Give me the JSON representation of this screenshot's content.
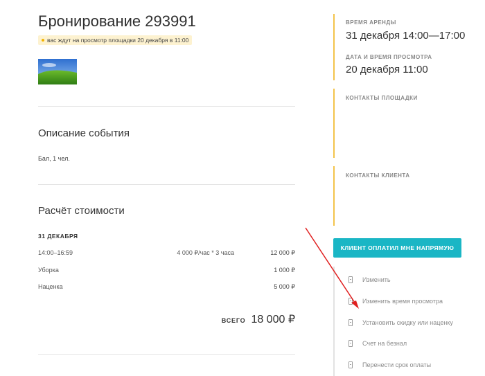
{
  "booking": {
    "title": "Бронирование 293991",
    "viewing_notice": "вас ждут на просмотр площадки 20 декабря в 11:00"
  },
  "event": {
    "section_title": "Описание события",
    "description": "Бал, 1 чел."
  },
  "cost": {
    "section_title": "Расчёт стоимости",
    "date": "31 ДЕКАБРЯ",
    "rows": [
      {
        "label": "14:00–16:59",
        "rate": "4 000 ₽/час * 3 часа",
        "amount": "12 000 ₽"
      },
      {
        "label": "Уборка",
        "rate": "",
        "amount": "1 000 ₽"
      },
      {
        "label": "Наценка",
        "rate": "",
        "amount": "5 000 ₽"
      }
    ],
    "total_label": "ВСЕГО",
    "total_value": "18 000 ₽"
  },
  "sidebar": {
    "rental_time_label": "ВРЕМЯ АРЕНДЫ",
    "rental_time_value": "31 декабря 14:00—17:00",
    "viewing_label": "ДАТА И ВРЕМЯ ПРОСМОТРА",
    "viewing_value": "20 декабря 11:00",
    "venue_contacts_label": "КОНТАКТЫ ПЛОЩАДКИ",
    "client_contacts_label": "КОНТАКТЫ КЛИЕНТА",
    "paid_button": "КЛИЕНТ ОПЛАТИЛ МНЕ НАПРЯМУЮ",
    "actions": [
      {
        "label": "Изменить",
        "icon": "document-icon"
      },
      {
        "label": "Изменить время просмотра",
        "icon": "document-icon"
      },
      {
        "label": "Установить скидку или наценку",
        "icon": "document-icon"
      },
      {
        "label": "Счет на безнал",
        "icon": "document-icon"
      },
      {
        "label": "Перенести срок оплаты",
        "icon": "document-icon"
      }
    ]
  },
  "colors": {
    "accent_teal": "#1ab6c5",
    "accent_yellow": "#f3c34a",
    "notice_bg": "#fdf2d0",
    "annotation_arrow": "#e02020"
  }
}
